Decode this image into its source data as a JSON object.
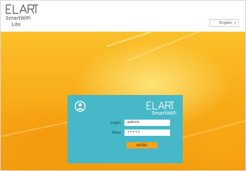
{
  "header": {
    "logo": {
      "brand": "ELART",
      "product_line1": "SmartWiFi",
      "product_line2": "Lite"
    },
    "language_select": {
      "selected": "English",
      "icon": "chevron-down-icon"
    }
  },
  "login_panel": {
    "user_icon": "user-avatar-icon",
    "logo": {
      "brand": "ELART",
      "product": "SmartWiFi"
    },
    "login_label": "Login",
    "login_value": "admin",
    "password_label": "Pass",
    "password_value": "•••••",
    "enter_label": "enter"
  },
  "colors": {
    "panel": "#46b8c7",
    "button": "#f6a21c",
    "background": "#f7aa16"
  }
}
